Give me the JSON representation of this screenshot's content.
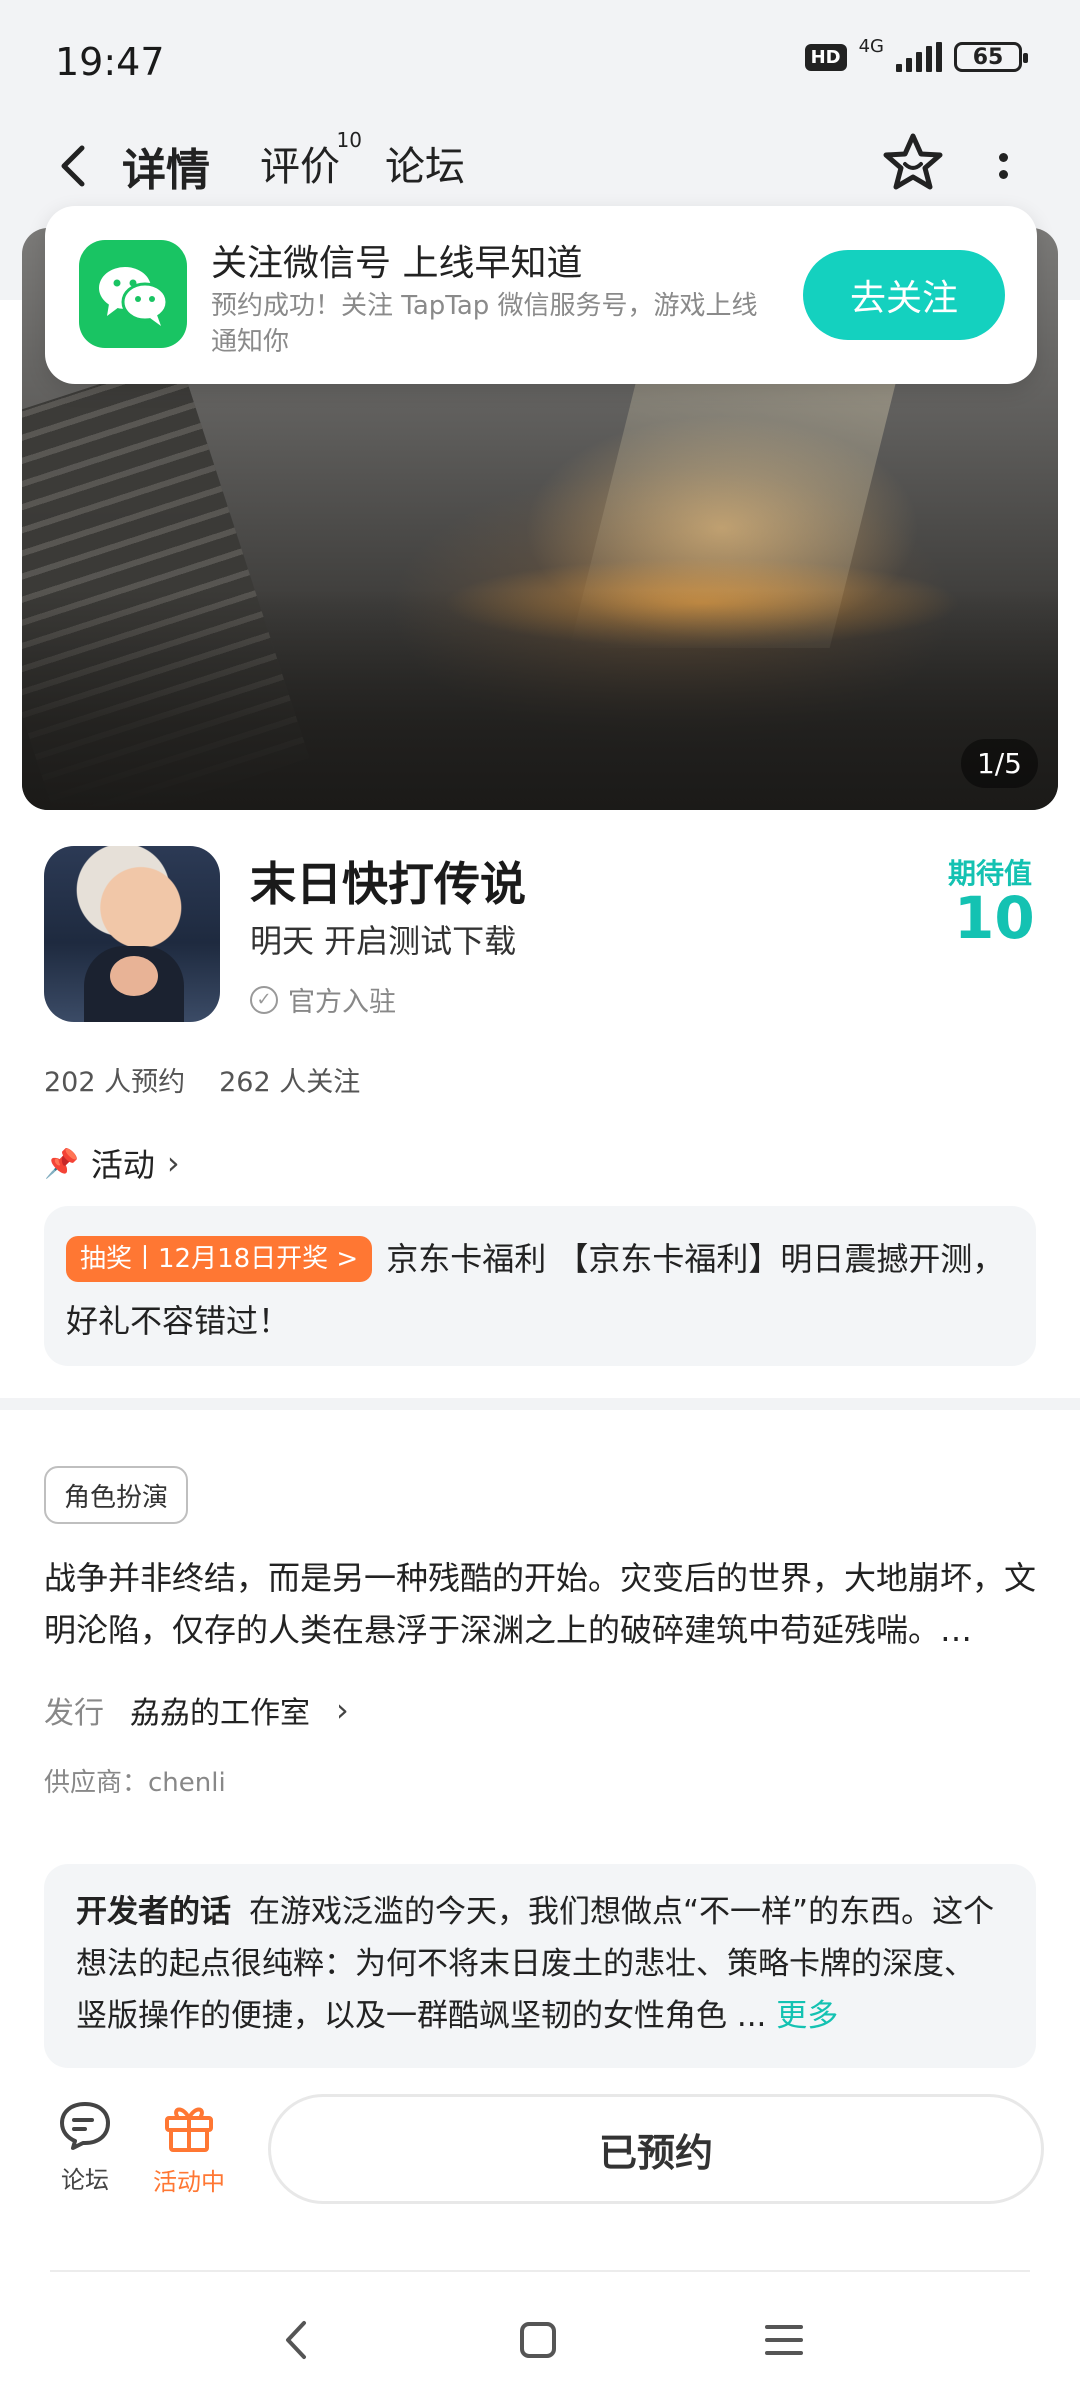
{
  "status": {
    "time": "19:47",
    "hd": "HD",
    "network": "4G",
    "battery": "65"
  },
  "nav": {
    "tab_detail": "详情",
    "tab_review": "评价",
    "review_count": "10",
    "tab_forum": "论坛"
  },
  "follow_card": {
    "title": "关注微信号 上线早知道",
    "desc": "预约成功！关注 TapTap 微信服务号，游戏上线通知你",
    "button": "去关注",
    "accent": "#14d1bf"
  },
  "banner": {
    "page_indicator": "1/5"
  },
  "game": {
    "title": "末日快打传说",
    "subtitle": "明天 开启测试下载",
    "official": "官方入驻",
    "expect_label": "期待值",
    "expect_value": "10",
    "reservations": "202 人预约",
    "followers": "262 人关注"
  },
  "activity": {
    "heading": "活动",
    "tag": "抽奖丨12月18日开奖 >",
    "text": "京东卡福利 【京东卡福利】明日震撼开测，好礼不容错过！",
    "tag_color": "#ff7733"
  },
  "about": {
    "genre": "角色扮演",
    "description": "战争并非终结，而是另一种残酷的开始。灾变后的世界，大地崩坏，文明沦陷，仅存的人类在悬浮于深渊之上的破碎建筑中苟延残喘。…",
    "publisher_label": "发行",
    "publisher_name": "劦劦的工作室",
    "supplier": "供应商：chenli"
  },
  "developer": {
    "label": "开发者的话",
    "text": "在游戏泛滥的今天，我们想做点“不一样”的东西。这个想法的起点很纯粹：为何不将末日废土的悲壮、策略卡牌的深度、竖版操作的便捷，以及一群酷飒坚韧的女性角色 ...",
    "more": "更多"
  },
  "bottom": {
    "forum": "论坛",
    "activity": "活动中",
    "reserved": "已预约"
  }
}
